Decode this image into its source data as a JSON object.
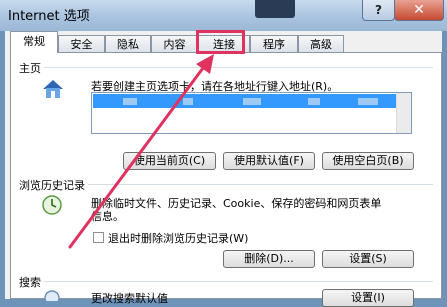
{
  "window": {
    "title": "Internet 选项",
    "help_label": "?",
    "close_label": "✕"
  },
  "tabs": [
    {
      "label": "常规",
      "active": true
    },
    {
      "label": "安全",
      "active": false
    },
    {
      "label": "隐私",
      "active": false
    },
    {
      "label": "内容",
      "active": false
    },
    {
      "label": "连接",
      "active": false,
      "highlighted": true
    },
    {
      "label": "程序",
      "active": false
    },
    {
      "label": "高级",
      "active": false
    }
  ],
  "homepage": {
    "group_label": "主页",
    "description": "若要创建主页选项卡，请在各地址行键入地址(R)。",
    "buttons": {
      "use_current": "使用当前页(C)",
      "use_default": "使用默认值(F)",
      "use_blank": "使用空白页(B)"
    }
  },
  "history": {
    "group_label": "浏览历史记录",
    "description_line1": "删除临时文件、历史记录、Cookie、保存的密码和网页表单",
    "description_line2": "信息。",
    "checkbox_label": "退出时删除浏览历史记录(W)",
    "checkbox_checked": false,
    "buttons": {
      "delete": "删除(D)...",
      "settings": "设置(S)"
    }
  },
  "search": {
    "group_label": "搜索",
    "description": "更改搜索默认值",
    "settings_button": "设置(I)"
  },
  "icons": {
    "home": "home-icon",
    "history": "history-icon",
    "search": "search-icon"
  },
  "colors": {
    "annotation": "#e0325e",
    "selection": "#3399ff"
  }
}
